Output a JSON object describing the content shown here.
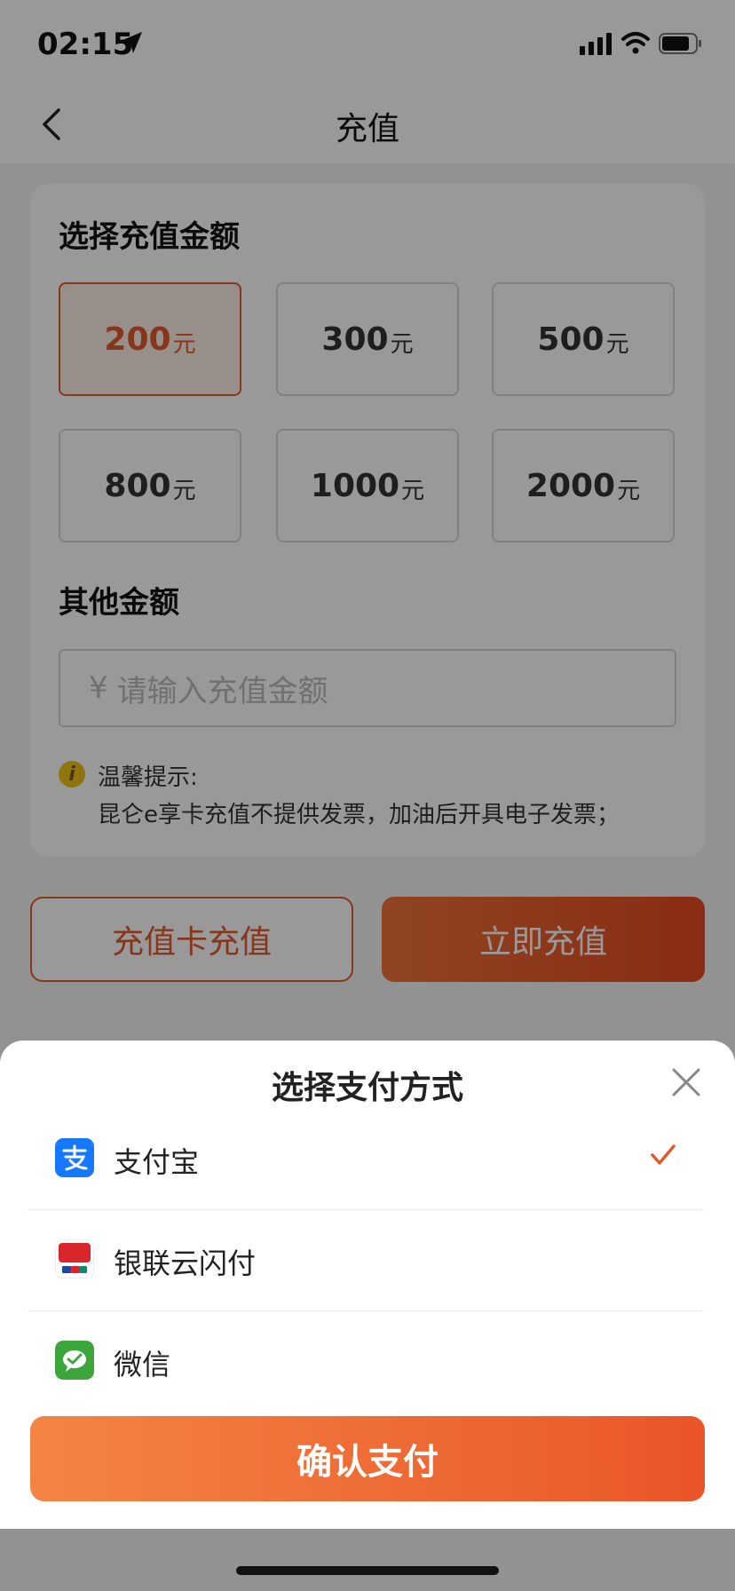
{
  "status": {
    "time": "02:15"
  },
  "nav": {
    "title": "充值"
  },
  "amount_section": {
    "title": "选择充值金额",
    "unit": "元",
    "options": [
      {
        "value": "200",
        "selected": true
      },
      {
        "value": "300",
        "selected": false
      },
      {
        "value": "500",
        "selected": false
      },
      {
        "value": "800",
        "selected": false
      },
      {
        "value": "1000",
        "selected": false
      },
      {
        "value": "2000",
        "selected": false
      }
    ]
  },
  "other_section": {
    "title": "其他金额",
    "currency": "¥",
    "placeholder": "请输入充值金额"
  },
  "tip": {
    "title": "温馨提示:",
    "text": "昆仑e享卡充值不提供发票，加油后开具电子发票；"
  },
  "buttons": {
    "card_recharge": "充值卡充值",
    "recharge_now": "立即充值"
  },
  "sheet": {
    "title": "选择支付方式",
    "methods": [
      {
        "label": "支付宝",
        "icon": "alipay-icon",
        "selected": true
      },
      {
        "label": "银联云闪付",
        "icon": "unionpay-icon",
        "selected": false
      },
      {
        "label": "微信",
        "icon": "wechat-icon",
        "selected": false
      }
    ],
    "confirm": "确认支付"
  },
  "colors": {
    "accent": "#e05a2e",
    "alipay": "#1677ff",
    "wechat": "#3ca63c",
    "unionpay": "#d9262c"
  }
}
